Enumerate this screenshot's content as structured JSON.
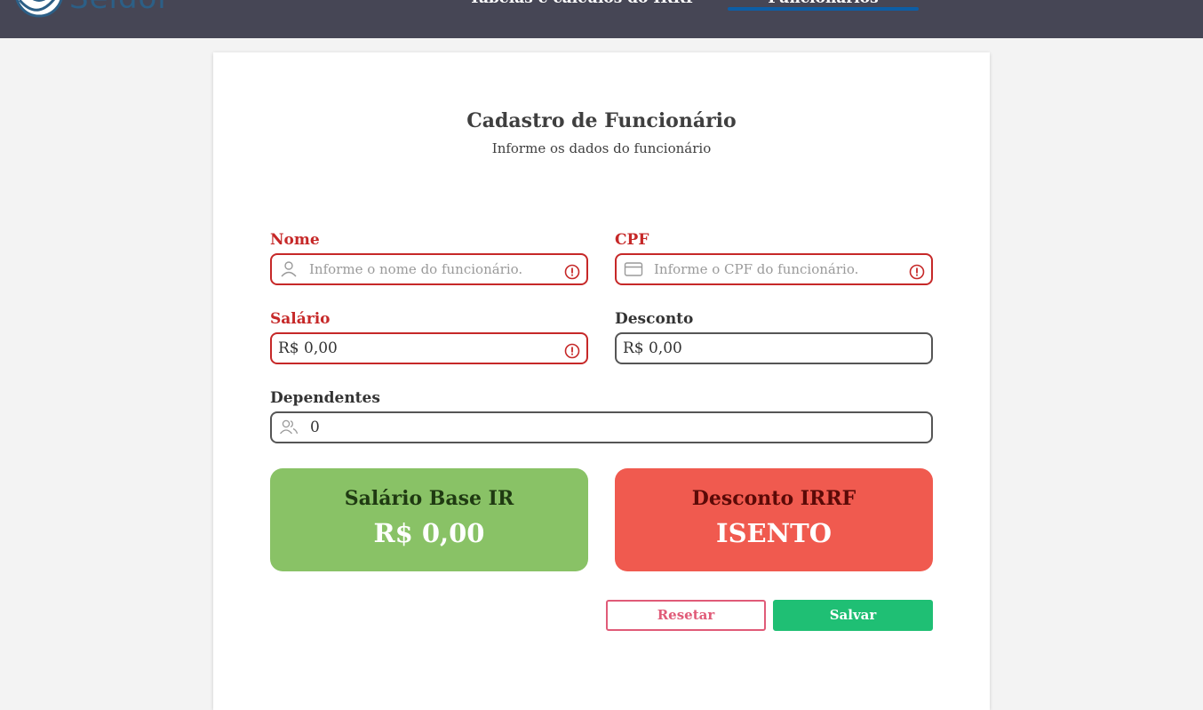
{
  "header": {
    "logo_text": "Seidor",
    "nav": [
      {
        "label": "Tabelas e cálculos do IRRF",
        "active": false
      },
      {
        "label": "Funcionários",
        "active": true
      }
    ]
  },
  "form": {
    "title": "Cadastro de Funcionário",
    "subtitle": "Informe os dados do funcionário",
    "fields": {
      "nome": {
        "label": "Nome",
        "placeholder": "Informe o nome do funcionário.",
        "value": "",
        "error": true,
        "icon": "user-icon"
      },
      "cpf": {
        "label": "CPF",
        "placeholder": "Informe o CPF do funcionário.",
        "value": "",
        "error": true,
        "icon": "card-icon"
      },
      "salario": {
        "label": "Salário",
        "value": "R$ 0,00",
        "error": true
      },
      "desconto": {
        "label": "Desconto",
        "value": "R$ 0,00",
        "error": false
      },
      "dependentes": {
        "label": "Dependentes",
        "value": "0",
        "error": false,
        "icon": "users-icon"
      }
    },
    "summary": {
      "base": {
        "title": "Salário Base IR",
        "value": "R$ 0,00"
      },
      "irrf": {
        "title": "Desconto IRRF",
        "value": "ISENTO"
      }
    },
    "actions": {
      "reset_label": "Resetar",
      "save_label": "Salvar"
    }
  },
  "colors": {
    "header_bg": "#464655",
    "error": "#c62828",
    "summary_base": "#89c266",
    "summary_irrf": "#f05a4f",
    "save": "#1fbf74",
    "reset": "#e05b78"
  }
}
